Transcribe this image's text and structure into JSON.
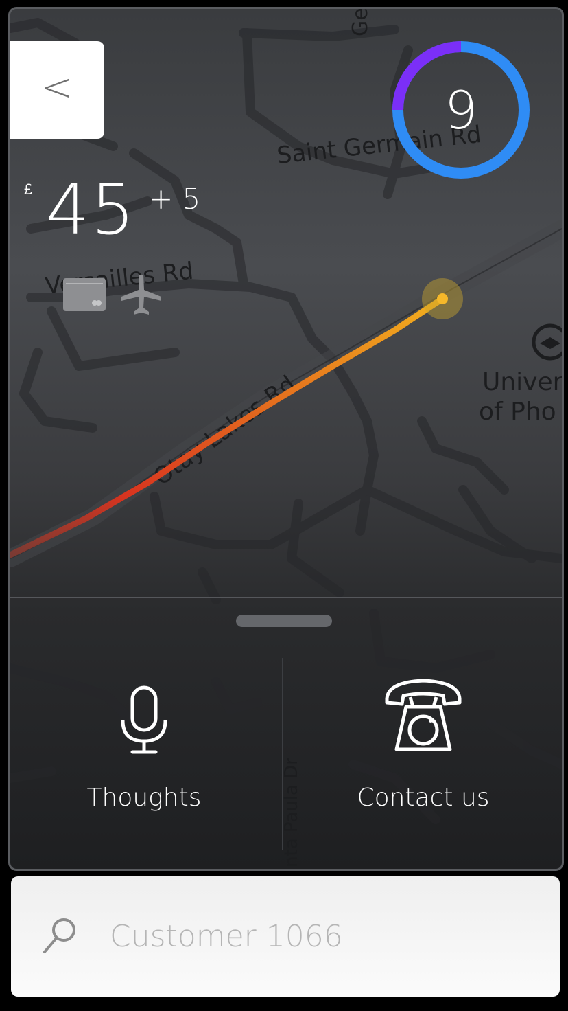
{
  "map": {
    "labels": {
      "saint_germain": "Saint Germain Rd",
      "versailles": "Versailles Rd",
      "otay_lakes": "Otay Lakes Rd",
      "university_1": "Univer",
      "university_2": "of Pho",
      "top_partial": "Ge",
      "santa_paula": "nta Paula Dr"
    }
  },
  "header": {
    "back_label": "<",
    "counter_value": "9",
    "counter_progress": 0.9,
    "counter_colors": {
      "start": "#7b2ff7",
      "end": "#2f8cf5"
    }
  },
  "fare": {
    "currency": "£",
    "amount": "45",
    "extra": "+ 5"
  },
  "icons": {
    "payment": "credit-card-icon",
    "mode": "airplane-icon"
  },
  "route": {
    "colors": {
      "start": "#d8341f",
      "end": "#f2b01e"
    },
    "marker_color": "#f5b82a"
  },
  "actions": {
    "thoughts": {
      "label": "Thoughts",
      "icon": "microphone-icon"
    },
    "contact": {
      "label": "Contact us",
      "icon": "telephone-icon"
    }
  },
  "search": {
    "placeholder": "Customer 1066",
    "icon": "search-icon"
  }
}
